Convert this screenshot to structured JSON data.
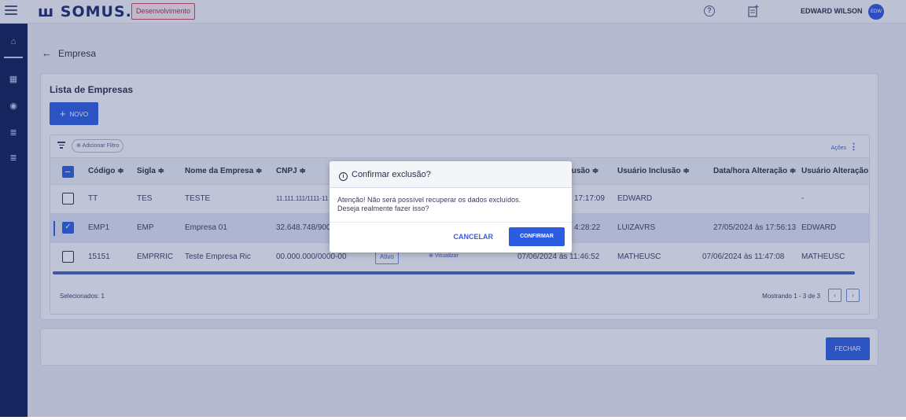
{
  "header": {
    "logo": "ꟺ SOMUS.",
    "environment": "Desenvolvimento",
    "user_name": "EDWARD WILSON",
    "avatar_initials": "EDW"
  },
  "breadcrumb": {
    "back_label": "Empresa"
  },
  "card": {
    "title": "Lista de Empresas",
    "new_button": "NOVO",
    "add_filter": "Adicionar Filtro",
    "actions_label": "Ações"
  },
  "table": {
    "columns": [
      "Código",
      "Sigla",
      "Nome da Empresa",
      "CNPJ",
      "lusão",
      "Usuário Inclusão",
      "Data/hora Alteração",
      "Usuário Alteração"
    ],
    "rows": [
      {
        "checked": false,
        "codigo": "TT",
        "sigla": "TES",
        "nome": "TESTE",
        "cnpj": "11.111.111/1111-11",
        "status": "",
        "visualizar": "",
        "data_inclusao": "17:17:09",
        "usuario_inclusao": "EDWARD",
        "data_alteracao": "",
        "usuario_alteracao": "-"
      },
      {
        "checked": true,
        "codigo": "EMP1",
        "sigla": "EMP",
        "nome": "Empresa 01",
        "cnpj": "32.648.748/900",
        "status": "",
        "visualizar": "",
        "data_inclusao": "4:28:22",
        "usuario_inclusao": "LUIZAVRS",
        "data_alteracao": "27/05/2024 às 17:56:13",
        "usuario_alteracao": "EDWARD"
      },
      {
        "checked": false,
        "codigo": "15151",
        "sigla": "EMPRRIC",
        "nome": "Teste Empresa Ric",
        "cnpj": "00.000.000/0000-00",
        "status": "Ativo",
        "visualizar": "Visualizar",
        "data_inclusao": "07/06/2024 às 11:46:52",
        "usuario_inclusao": "MATHEUSC",
        "data_alteracao": "07/06/2024 às 11:47:08",
        "usuario_alteracao": "MATHEUSC"
      }
    ]
  },
  "footer": {
    "selected": "Selecionados: 1",
    "pagination": "Mostrando 1 - 3 de 3",
    "prev": "‹",
    "next": "›",
    "close_button": "FECHAR"
  },
  "modal": {
    "title": "Confirmar exclusão?",
    "message_line1": "Atenção! Não será possível recuperar os dados excluídos.",
    "message_line2": "Deseja realmente fazer isso?",
    "cancel": "CANCELAR",
    "confirm": "CONFIRMAR"
  },
  "colors": {
    "primary": "#2c5ce0",
    "rail": "#0d1d54",
    "environment_border": "#c9425a"
  }
}
